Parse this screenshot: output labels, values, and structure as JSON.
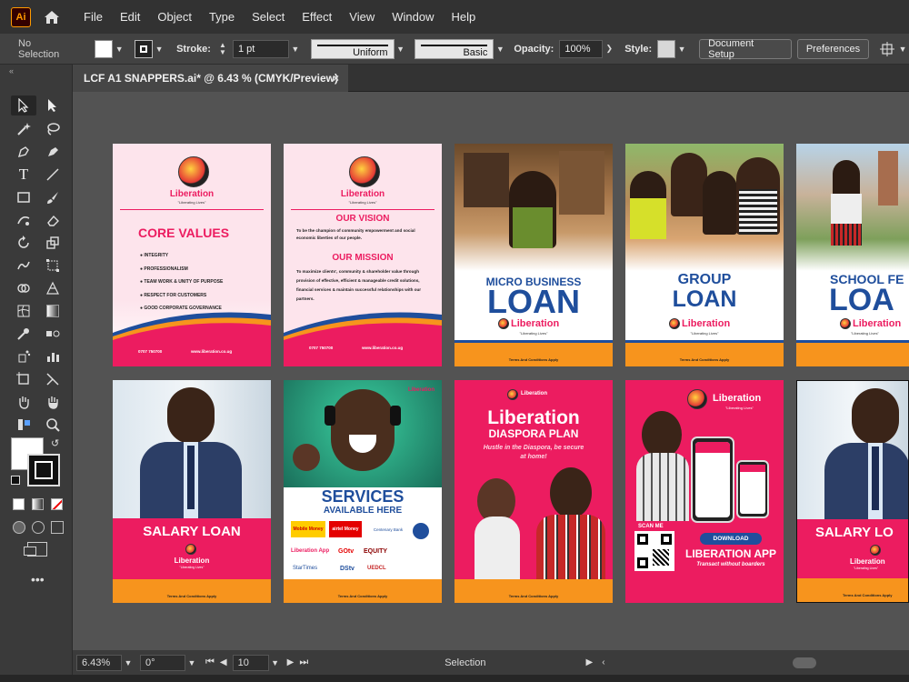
{
  "app": {
    "logo": "Ai",
    "home_icon": "home-icon"
  },
  "menu": [
    "File",
    "Edit",
    "Object",
    "Type",
    "Select",
    "Effect",
    "View",
    "Window",
    "Help"
  ],
  "control_bar": {
    "selection": "No Selection",
    "stroke_label": "Stroke:",
    "stroke_weight": "1 pt",
    "profile": "Uniform",
    "brush": "Basic",
    "opacity_label": "Opacity:",
    "opacity": "100%",
    "style_label": "Style:",
    "document_setup": "Document Setup",
    "preferences": "Preferences"
  },
  "document_tab": {
    "title": "LCF A1 SNAPPERS.ai* @ 6.43 % (CMYK/Preview)",
    "close": "×"
  },
  "status_bar": {
    "zoom": "6.43%",
    "rotation": "0°",
    "artboard": "10",
    "tool": "Selection"
  },
  "artboards": {
    "a1": {
      "brand": "Liberation",
      "tagline": "\"Liberating Lives\"",
      "heading": "CORE VALUES",
      "values": [
        "INTEGRITY",
        "PROFESSIONALISM",
        "TEAM WORK & UNITY OF PURPOSE",
        "RESPECT FOR CUSTOMERS",
        "GOOD CORPORATE GOVERNANCE"
      ],
      "phone": "0707 750700",
      "web": "www.liberation.co.ug"
    },
    "a2": {
      "brand": "Liberation",
      "tagline": "\"Liberating Lives\"",
      "vision_title": "OUR VISION",
      "vision_text": "To be the champion of community empowerment and social economic liberties of our people.",
      "mission_title": "OUR MISSION",
      "mission_text": "To maximize clients', community & shareholder value through provision of effective, efficient & manageable credit solutions, financial services & maintain successful relationships with our partners.",
      "phone": "0707 750700",
      "web": "www.liberation.co.ug"
    },
    "a3": {
      "line1": "MICRO BUSINESS",
      "line2": "LOAN",
      "brand": "Liberation",
      "tagline": "\"Liberating Lives\"",
      "terms": "Terms And Conditions Apply"
    },
    "a4": {
      "line1": "GROUP",
      "line2": "LOAN",
      "brand": "Liberation",
      "tagline": "\"Liberating Lives\"",
      "terms": "Terms And Conditions Apply"
    },
    "a5": {
      "line1": "SCHOOL FE",
      "line2": "LOA",
      "brand": "Liberation",
      "tagline": "\"Liberating Lives\""
    },
    "a6": {
      "heading": "SALARY LOAN",
      "brand": "Liberation",
      "tagline": "\"Liberating Lives\"",
      "terms": "Terms And Conditions Apply"
    },
    "a7": {
      "brand": "Liberation",
      "line1": "SERVICES",
      "line2": "AVAILABLE HERE",
      "partners": [
        "Mobile Money",
        "airtel Money",
        "Centenary Bank",
        "Liberation App",
        "GOtv",
        "EQUITY",
        "StarTimes",
        "DStv",
        "UEDCL"
      ],
      "terms": "Terms And Conditions Apply"
    },
    "a8": {
      "brand": "Liberation",
      "heading": "Liberation",
      "sub": "DIASPORA PLAN",
      "slogan": "Hustle in the Diaspora, be secure at home!",
      "terms": "Terms And Conditions Apply"
    },
    "a9": {
      "brand": "Liberation",
      "tagline": "\"Liberating Lives\"",
      "scan": "SCAN ME",
      "download": "DOWNLOAD",
      "app": "LIBERATION APP",
      "slogan": "Transact without boarders"
    },
    "a10": {
      "heading": "SALARY LO",
      "brand": "Liberation",
      "tagline": "\"Liberating Lives\"",
      "terms": "Terms And Conditions Apply"
    }
  }
}
